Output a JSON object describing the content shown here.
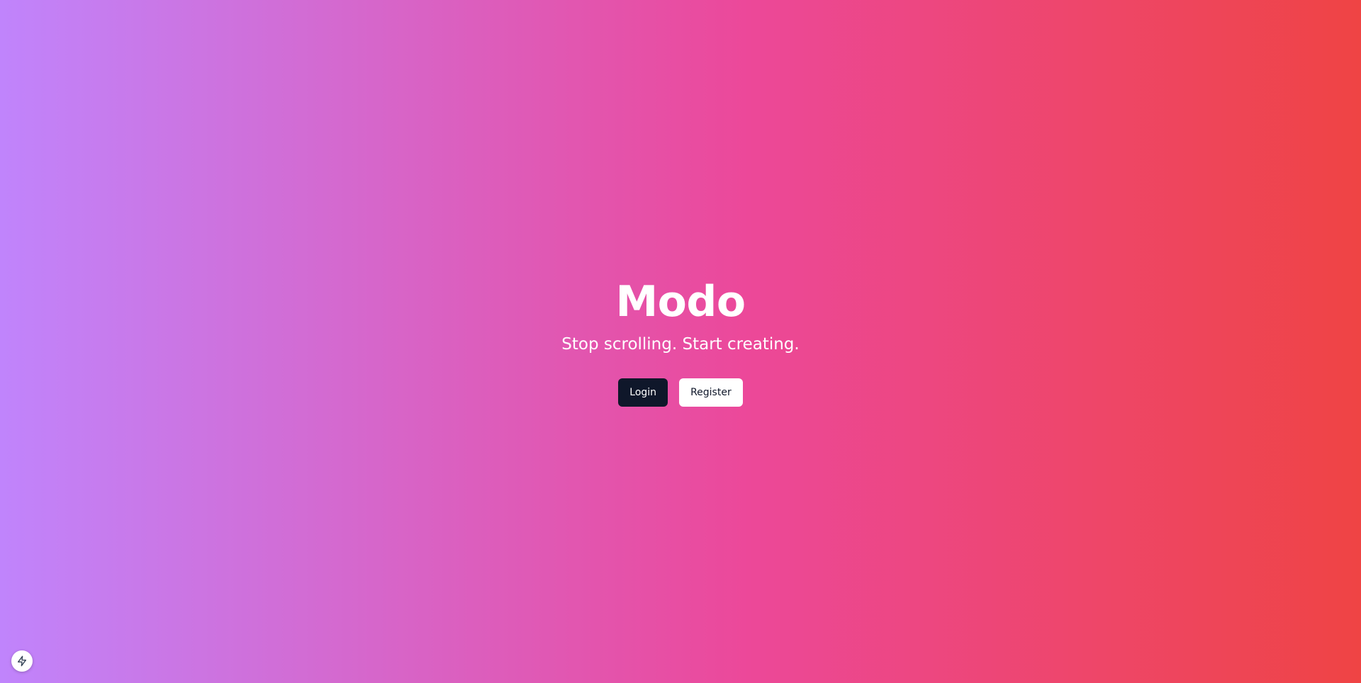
{
  "hero": {
    "title": "Modo",
    "subtitle": "Stop scrolling. Start creating."
  },
  "actions": {
    "login_label": "Login",
    "register_label": "Register"
  },
  "floating": {
    "icon": "lightning-bolt-icon"
  },
  "colors": {
    "gradient_start": "#c084fc",
    "gradient_mid": "#ec4899",
    "gradient_end": "#ef4444",
    "login_bg": "#0f172a",
    "register_bg": "#ffffff"
  }
}
